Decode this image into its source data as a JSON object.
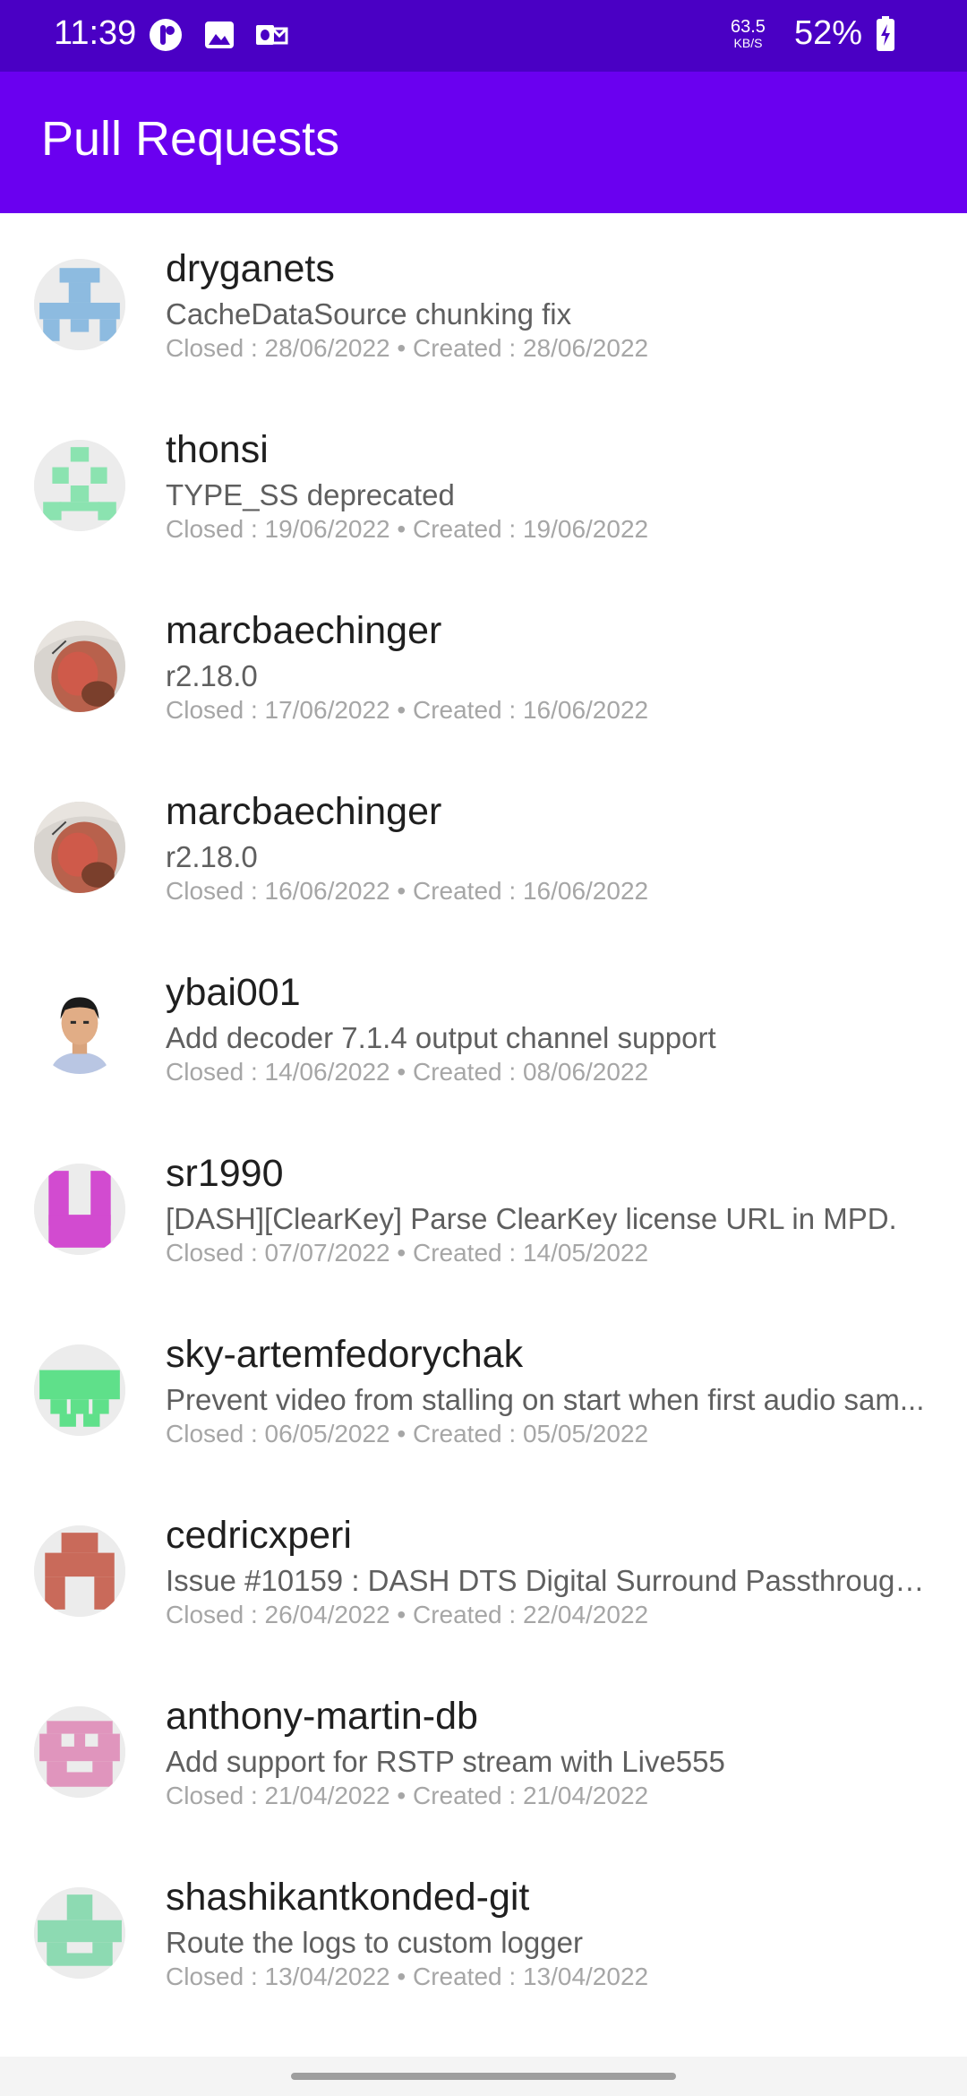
{
  "status_bar": {
    "time": "11:39",
    "net_speed_value": "63.5",
    "net_speed_unit": "KB/S",
    "battery": "52%",
    "icons": [
      "app-notification-icon",
      "image-icon",
      "outlook-icon",
      "battery-charging-icon"
    ]
  },
  "app_bar": {
    "title": "Pull Requests"
  },
  "pull_requests": [
    {
      "name": "dryganets",
      "title": "CacheDataSource chunking fix",
      "meta": "Closed : 28/06/2022 • Created : 28/06/2022",
      "avatar": "identicon",
      "avatar_color": "#8dbbe0"
    },
    {
      "name": "thonsi",
      "title": "TYPE_SS deprecated",
      "meta": "Closed : 19/06/2022 • Created : 19/06/2022",
      "avatar": "identicon",
      "avatar_color": "#8be3b0"
    },
    {
      "name": "marcbaechinger",
      "title": "r2.18.0",
      "meta": "Closed : 17/06/2022 • Created : 16/06/2022",
      "avatar": "photo"
    },
    {
      "name": "marcbaechinger",
      "title": "r2.18.0",
      "meta": "Closed : 16/06/2022 • Created : 16/06/2022",
      "avatar": "photo"
    },
    {
      "name": "ybai001",
      "title": "Add decoder 7.1.4 output channel support",
      "meta": "Closed : 14/06/2022 • Created : 08/06/2022",
      "avatar": "photo"
    },
    {
      "name": "sr1990",
      "title": "[DASH][ClearKey] Parse ClearKey license URL in MPD.",
      "meta": "Closed : 07/07/2022 • Created : 14/05/2022",
      "avatar": "identicon",
      "avatar_color": "#d24bd0"
    },
    {
      "name": "sky-artemfedorychak",
      "title": "Prevent video from stalling on start when first audio sam...",
      "meta": "Closed : 06/05/2022 • Created : 05/05/2022",
      "avatar": "identicon",
      "avatar_color": "#5fe08a"
    },
    {
      "name": "cedricxperi",
      "title": "Issue #10159 : DASH DTS Digital Surround Passthrough ...",
      "meta": "Closed : 26/04/2022 • Created : 22/04/2022",
      "avatar": "identicon",
      "avatar_color": "#c96a5a"
    },
    {
      "name": "anthony-martin-db",
      "title": "Add support for RSTP stream with Live555",
      "meta": "Closed : 21/04/2022 • Created : 21/04/2022",
      "avatar": "identicon",
      "avatar_color": "#e095bd"
    },
    {
      "name": "shashikantkonded-git",
      "title": "Route the logs to custom logger",
      "meta": "Closed : 13/04/2022 • Created : 13/04/2022",
      "avatar": "identicon",
      "avatar_color": "#8ddab2"
    }
  ]
}
